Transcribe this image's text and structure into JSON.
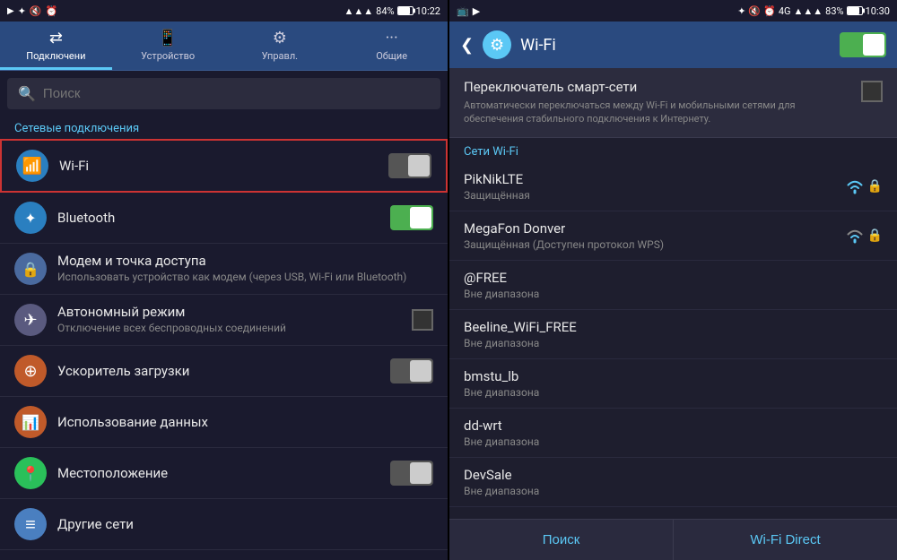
{
  "left": {
    "statusBar": {
      "time": "10:22",
      "battery": "84%",
      "icons": "▶ ✦ ⊗ ⊙ ⊕ ▲ ▲▲▲"
    },
    "tabs": [
      {
        "id": "connections",
        "label": "Подключени",
        "icon": "⇄",
        "active": true
      },
      {
        "id": "device",
        "label": "Устройство",
        "icon": "📱",
        "active": false
      },
      {
        "id": "manage",
        "label": "Управл.",
        "icon": "⚙",
        "active": false
      },
      {
        "id": "general",
        "label": "Общие",
        "icon": "···",
        "active": false
      }
    ],
    "searchPlaceholder": "Поиск",
    "sectionLabel": "Сетевые подключения",
    "items": [
      {
        "id": "wifi",
        "title": "Wi-Fi",
        "subtitle": "",
        "iconType": "wifi",
        "iconSymbol": "📶",
        "toggle": true,
        "toggleState": "off",
        "highlighted": true
      },
      {
        "id": "bluetooth",
        "title": "Bluetooth",
        "subtitle": "",
        "iconType": "bt",
        "iconSymbol": "✦",
        "toggle": true,
        "toggleState": "on"
      },
      {
        "id": "modem",
        "title": "Модем и точка доступа",
        "subtitle": "Использовать устройство как модем (через USB, Wi-Fi или Bluetooth)",
        "iconType": "modem",
        "iconSymbol": "🔒",
        "toggle": false
      },
      {
        "id": "airplane",
        "title": "Автономный режим",
        "subtitle": "Отключение всех беспроводных соединений",
        "iconType": "airplane",
        "iconSymbol": "✈",
        "toggle": false,
        "checkbox": true
      },
      {
        "id": "download",
        "title": "Ускоритель загрузки",
        "subtitle": "",
        "iconType": "download",
        "iconSymbol": "⊕",
        "toggle": true,
        "toggleState": "off"
      },
      {
        "id": "data",
        "title": "Использование данных",
        "subtitle": "",
        "iconType": "data",
        "iconSymbol": "📊",
        "toggle": false
      },
      {
        "id": "location",
        "title": "Местоположение",
        "subtitle": "",
        "iconType": "location",
        "iconSymbol": "📍",
        "toggle": true,
        "toggleState": "off"
      },
      {
        "id": "other",
        "title": "Другие сети",
        "subtitle": "",
        "iconType": "other",
        "iconSymbol": "≡",
        "toggle": false
      }
    ]
  },
  "right": {
    "statusBar": {
      "time": "10:30",
      "battery": "83%"
    },
    "header": {
      "title": "Wi-Fi",
      "toggleState": "on"
    },
    "smartSwitch": {
      "title": "Переключатель смарт-сети",
      "description": "Автоматически переключаться между Wi-Fi и мобильными сетями для обеспечения стабильного подключения к Интернету."
    },
    "wifiSectionLabel": "Сети Wi-Fi",
    "networks": [
      {
        "name": "PikNikLTE",
        "status": "Защищённая",
        "signal": 3,
        "locked": true
      },
      {
        "name": "MegaFon Donver",
        "status": "Защищённая (Доступен протокол WPS)",
        "signal": 2,
        "locked": true
      },
      {
        "name": "@FREE",
        "status": "Вне диапазона",
        "signal": 0,
        "locked": false
      },
      {
        "name": "Beeline_WiFi_FREE",
        "status": "Вне диапазона",
        "signal": 0,
        "locked": false
      },
      {
        "name": "bmstu_lb",
        "status": "Вне диапазона",
        "signal": 0,
        "locked": false
      },
      {
        "name": "dd-wrt",
        "status": "Вне диапазона",
        "signal": 0,
        "locked": false
      },
      {
        "name": "DevSale",
        "status": "Вне диапазона",
        "signal": 0,
        "locked": false
      }
    ],
    "bottomButtons": [
      {
        "label": "Поиск",
        "id": "search-btn"
      },
      {
        "label": "Wi-Fi Direct",
        "id": "direct-btn"
      }
    ]
  }
}
